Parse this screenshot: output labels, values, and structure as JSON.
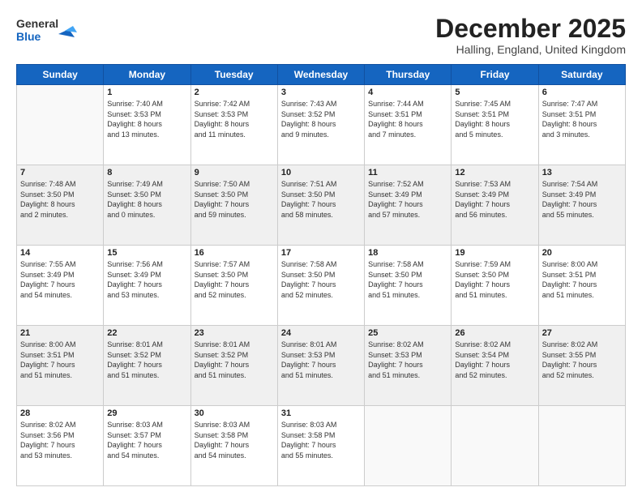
{
  "header": {
    "logo_line1": "General",
    "logo_line2": "Blue",
    "month": "December 2025",
    "location": "Halling, England, United Kingdom"
  },
  "days_of_week": [
    "Sunday",
    "Monday",
    "Tuesday",
    "Wednesday",
    "Thursday",
    "Friday",
    "Saturday"
  ],
  "weeks": [
    [
      {
        "day": "",
        "info": ""
      },
      {
        "day": "1",
        "info": "Sunrise: 7:40 AM\nSunset: 3:53 PM\nDaylight: 8 hours\nand 13 minutes."
      },
      {
        "day": "2",
        "info": "Sunrise: 7:42 AM\nSunset: 3:53 PM\nDaylight: 8 hours\nand 11 minutes."
      },
      {
        "day": "3",
        "info": "Sunrise: 7:43 AM\nSunset: 3:52 PM\nDaylight: 8 hours\nand 9 minutes."
      },
      {
        "day": "4",
        "info": "Sunrise: 7:44 AM\nSunset: 3:51 PM\nDaylight: 8 hours\nand 7 minutes."
      },
      {
        "day": "5",
        "info": "Sunrise: 7:45 AM\nSunset: 3:51 PM\nDaylight: 8 hours\nand 5 minutes."
      },
      {
        "day": "6",
        "info": "Sunrise: 7:47 AM\nSunset: 3:51 PM\nDaylight: 8 hours\nand 3 minutes."
      }
    ],
    [
      {
        "day": "7",
        "info": "Sunrise: 7:48 AM\nSunset: 3:50 PM\nDaylight: 8 hours\nand 2 minutes."
      },
      {
        "day": "8",
        "info": "Sunrise: 7:49 AM\nSunset: 3:50 PM\nDaylight: 8 hours\nand 0 minutes."
      },
      {
        "day": "9",
        "info": "Sunrise: 7:50 AM\nSunset: 3:50 PM\nDaylight: 7 hours\nand 59 minutes."
      },
      {
        "day": "10",
        "info": "Sunrise: 7:51 AM\nSunset: 3:50 PM\nDaylight: 7 hours\nand 58 minutes."
      },
      {
        "day": "11",
        "info": "Sunrise: 7:52 AM\nSunset: 3:49 PM\nDaylight: 7 hours\nand 57 minutes."
      },
      {
        "day": "12",
        "info": "Sunrise: 7:53 AM\nSunset: 3:49 PM\nDaylight: 7 hours\nand 56 minutes."
      },
      {
        "day": "13",
        "info": "Sunrise: 7:54 AM\nSunset: 3:49 PM\nDaylight: 7 hours\nand 55 minutes."
      }
    ],
    [
      {
        "day": "14",
        "info": "Sunrise: 7:55 AM\nSunset: 3:49 PM\nDaylight: 7 hours\nand 54 minutes."
      },
      {
        "day": "15",
        "info": "Sunrise: 7:56 AM\nSunset: 3:49 PM\nDaylight: 7 hours\nand 53 minutes."
      },
      {
        "day": "16",
        "info": "Sunrise: 7:57 AM\nSunset: 3:50 PM\nDaylight: 7 hours\nand 52 minutes."
      },
      {
        "day": "17",
        "info": "Sunrise: 7:58 AM\nSunset: 3:50 PM\nDaylight: 7 hours\nand 52 minutes."
      },
      {
        "day": "18",
        "info": "Sunrise: 7:58 AM\nSunset: 3:50 PM\nDaylight: 7 hours\nand 51 minutes."
      },
      {
        "day": "19",
        "info": "Sunrise: 7:59 AM\nSunset: 3:50 PM\nDaylight: 7 hours\nand 51 minutes."
      },
      {
        "day": "20",
        "info": "Sunrise: 8:00 AM\nSunset: 3:51 PM\nDaylight: 7 hours\nand 51 minutes."
      }
    ],
    [
      {
        "day": "21",
        "info": "Sunrise: 8:00 AM\nSunset: 3:51 PM\nDaylight: 7 hours\nand 51 minutes."
      },
      {
        "day": "22",
        "info": "Sunrise: 8:01 AM\nSunset: 3:52 PM\nDaylight: 7 hours\nand 51 minutes."
      },
      {
        "day": "23",
        "info": "Sunrise: 8:01 AM\nSunset: 3:52 PM\nDaylight: 7 hours\nand 51 minutes."
      },
      {
        "day": "24",
        "info": "Sunrise: 8:01 AM\nSunset: 3:53 PM\nDaylight: 7 hours\nand 51 minutes."
      },
      {
        "day": "25",
        "info": "Sunrise: 8:02 AM\nSunset: 3:53 PM\nDaylight: 7 hours\nand 51 minutes."
      },
      {
        "day": "26",
        "info": "Sunrise: 8:02 AM\nSunset: 3:54 PM\nDaylight: 7 hours\nand 52 minutes."
      },
      {
        "day": "27",
        "info": "Sunrise: 8:02 AM\nSunset: 3:55 PM\nDaylight: 7 hours\nand 52 minutes."
      }
    ],
    [
      {
        "day": "28",
        "info": "Sunrise: 8:02 AM\nSunset: 3:56 PM\nDaylight: 7 hours\nand 53 minutes."
      },
      {
        "day": "29",
        "info": "Sunrise: 8:03 AM\nSunset: 3:57 PM\nDaylight: 7 hours\nand 54 minutes."
      },
      {
        "day": "30",
        "info": "Sunrise: 8:03 AM\nSunset: 3:58 PM\nDaylight: 7 hours\nand 54 minutes."
      },
      {
        "day": "31",
        "info": "Sunrise: 8:03 AM\nSunset: 3:58 PM\nDaylight: 7 hours\nand 55 minutes."
      },
      {
        "day": "",
        "info": ""
      },
      {
        "day": "",
        "info": ""
      },
      {
        "day": "",
        "info": ""
      }
    ]
  ]
}
